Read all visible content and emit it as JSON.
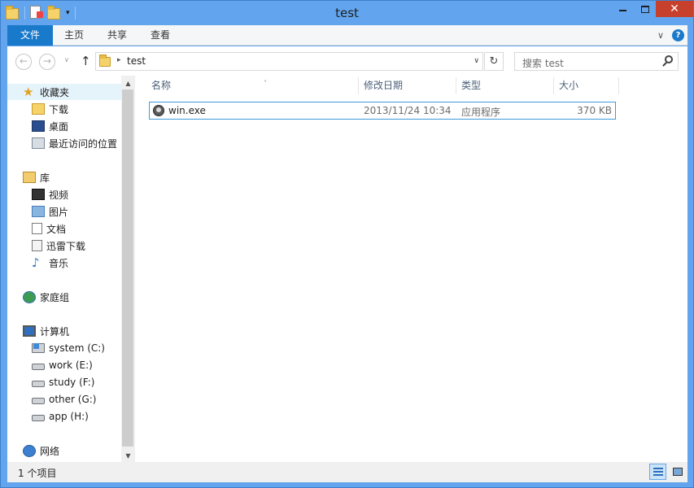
{
  "window": {
    "title": "test"
  },
  "quick_access": {
    "dropdown_glyph": "▾"
  },
  "caption": {
    "minimize": "",
    "maximize": "",
    "close": "✕"
  },
  "ribbon": {
    "tabs": [
      "文件",
      "主页",
      "共享",
      "查看"
    ],
    "expand_glyph": "∨",
    "help_glyph": "?"
  },
  "address": {
    "back_glyph": "←",
    "forward_glyph": "→",
    "up_glyph": "↑",
    "crumb_sep": "▸",
    "path": "test",
    "dropdown_glyph": "∨",
    "refresh_glyph": "↻",
    "search_placeholder": "搜索 test"
  },
  "nav": {
    "favorites": {
      "label": "收藏夹",
      "items": [
        "下载",
        "桌面",
        "最近访问的位置"
      ]
    },
    "libraries": {
      "label": "库",
      "items": [
        "视频",
        "图片",
        "文档",
        "迅雷下载",
        "音乐"
      ]
    },
    "homegroup": {
      "label": "家庭组"
    },
    "computer": {
      "label": "计算机",
      "items": [
        "system (C:)",
        "work (E:)",
        "study (F:)",
        "other (G:)",
        "app (H:)"
      ]
    },
    "network": {
      "label": "网络"
    },
    "scroll_up": "▲",
    "scroll_down": "▼"
  },
  "columns": {
    "name": "名称",
    "date": "修改日期",
    "type": "类型",
    "size": "大小",
    "sort_glyph": "˄"
  },
  "files": [
    {
      "name": "win.exe",
      "date": "2013/11/24 10:34",
      "type": "应用程序",
      "size": "370 KB"
    }
  ],
  "status": {
    "count": "1 个项目"
  },
  "colors": {
    "frame": "#62a5ee",
    "accent": "#1979ca",
    "close": "#c7402b",
    "selection_border": "#3f99d9"
  }
}
